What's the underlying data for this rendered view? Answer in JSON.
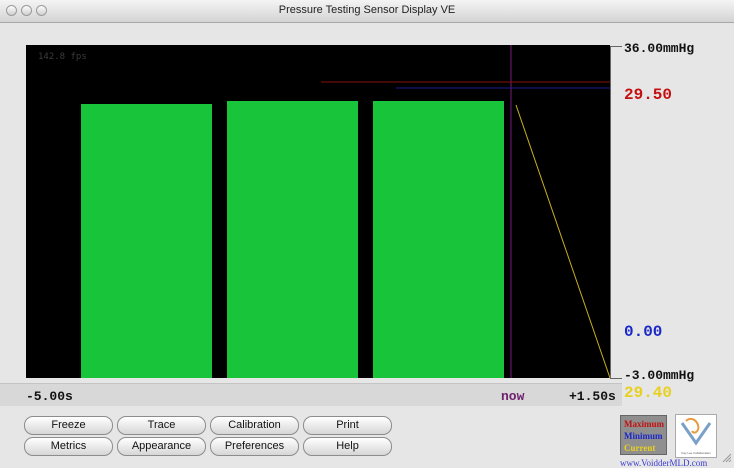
{
  "window": {
    "title": "Pressure Testing Sensor Display VE"
  },
  "graph": {
    "fps": "142.8 fps",
    "bars": [
      {
        "value": 29.1
      },
      {
        "value": 29.5
      },
      {
        "value": 29.4
      }
    ],
    "bar_color": "#17c43a"
  },
  "scale": {
    "top_label": "36.00mmHg",
    "bottom_label": "-3.00mmHg",
    "max_value": "29.50",
    "min_value": "0.00",
    "current_value": "29.40"
  },
  "time_axis": {
    "left": "-5.00s",
    "now": "now",
    "right": "+1.50s"
  },
  "buttons": {
    "freeze": "Freeze",
    "trace": "Trace",
    "calibration": "Calibration",
    "print": "Print",
    "metrics": "Metrics",
    "appearance": "Appearance",
    "preferences": "Preferences",
    "help": "Help"
  },
  "legend": {
    "maximum": "Maximum",
    "minimum": "Minimum",
    "current": "Current",
    "colors": {
      "maximum": "#c41010",
      "minimum": "#1a28c8",
      "current": "#e8d020"
    }
  },
  "logo": {
    "name": "chevron-logo",
    "caption": "Cay Lee Collaboration"
  },
  "footer": {
    "url": "www.VoidderMLD.com"
  }
}
